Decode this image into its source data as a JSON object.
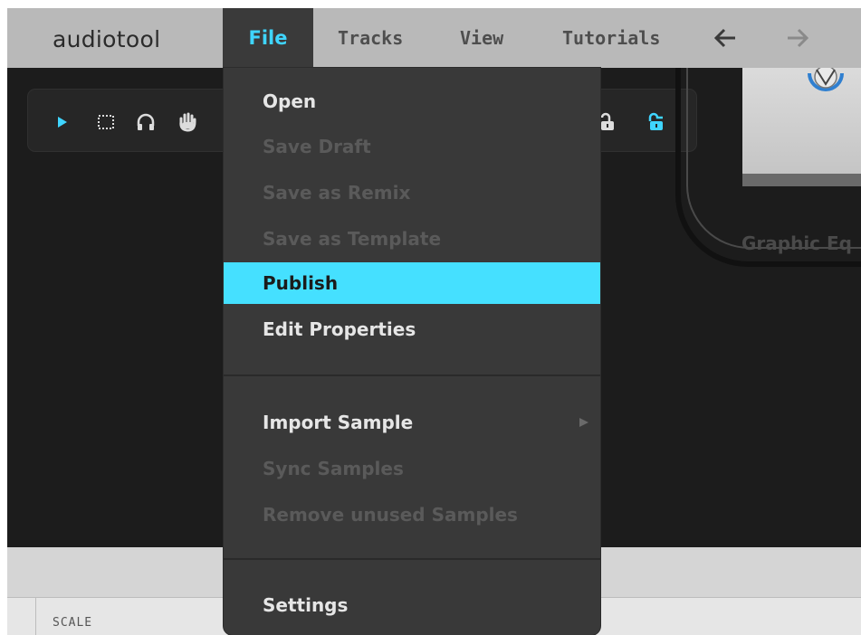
{
  "app": {
    "logo": "audiotool"
  },
  "menubar": {
    "items": [
      {
        "label": "File"
      },
      {
        "label": "Tracks"
      },
      {
        "label": "View"
      },
      {
        "label": "Tutorials"
      }
    ]
  },
  "toolbar": {
    "tools": [
      "pointer-icon",
      "marquee-select-icon",
      "headphones-icon",
      "hand-icon",
      "unlock-icon",
      "lock-icon"
    ]
  },
  "device": {
    "label": "Graphic Eq"
  },
  "lower_panel": {
    "scale_label": "SCALE"
  },
  "file_menu": {
    "items": [
      {
        "label": "Open",
        "enabled": true
      },
      {
        "label": "Save Draft",
        "enabled": false
      },
      {
        "label": "Save as Remix",
        "enabled": false
      },
      {
        "label": "Save as Template",
        "enabled": false
      },
      {
        "label": "Publish",
        "enabled": true,
        "highlighted": true
      },
      {
        "label": "Edit Properties",
        "enabled": true
      },
      {
        "label": "Import Sample",
        "enabled": true,
        "has_submenu": true
      },
      {
        "label": "Sync Samples",
        "enabled": false
      },
      {
        "label": "Remove unused Samples",
        "enabled": false
      },
      {
        "label": "Settings",
        "enabled": true
      }
    ]
  },
  "colors": {
    "accent": "#45e0ff",
    "menubar": "#b9b9b9",
    "menu_bg": "#393939",
    "workspace": "#1c1c1c"
  }
}
